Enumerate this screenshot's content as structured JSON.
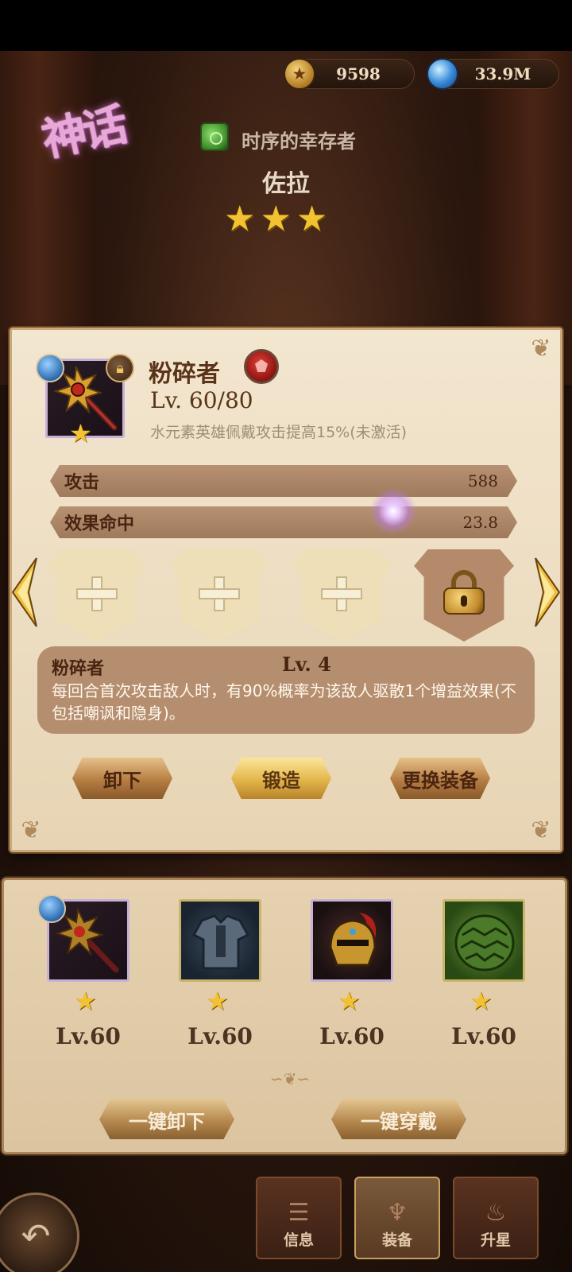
{
  "currency": {
    "gold": "9598",
    "crystal": "33.9M"
  },
  "hero": {
    "rarity_label": "神话",
    "title": "时序的幸存者",
    "name": "佐拉",
    "stars": 3
  },
  "equipment_detail": {
    "name": "粉碎者",
    "level": "Lv. 60/80",
    "set_bonus": "水元素英雄佩戴攻击提高15%(未激活)",
    "stars": 1,
    "stats": [
      {
        "label": "攻击",
        "value": "588"
      },
      {
        "label": "效果命中",
        "value": "23.8"
      }
    ],
    "gem_slots": [
      "empty",
      "empty",
      "empty",
      "locked"
    ],
    "skill": {
      "name": "粉碎者",
      "level": "Lv. 4",
      "description": "每回合首次攻击敌人时，有90%概率为该敌人驱散1个增益效果(不包括嘲讽和隐身)。"
    },
    "buttons": {
      "unequip": "卸下",
      "forge": "锻造",
      "replace": "更换装备"
    }
  },
  "equipped_items": [
    {
      "slot": "weapon",
      "level": "Lv.60",
      "stars": 1
    },
    {
      "slot": "armor",
      "level": "Lv.60",
      "stars": 1
    },
    {
      "slot": "helmet",
      "level": "Lv.60",
      "stars": 1
    },
    {
      "slot": "boots",
      "level": "Lv.60",
      "stars": 1
    }
  ],
  "bulk_buttons": {
    "unequip_all": "一键卸下",
    "equip_all": "一键穿戴"
  },
  "nav": {
    "info": "信息",
    "equipment": "装备",
    "star_up": "升星",
    "active": "equipment"
  },
  "colors": {
    "panel_bg": "#f3e6cf",
    "stat_bar": "#b79172",
    "star": "#f2c230",
    "gold_button": "#e3b54a"
  }
}
